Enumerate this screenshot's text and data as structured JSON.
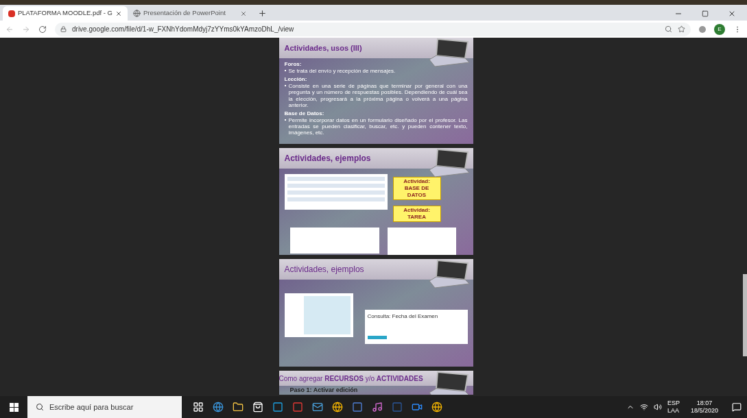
{
  "browser": {
    "tabs": [
      {
        "title": "PLATAFORMA MOODLE.pdf - G",
        "selected": true,
        "kind": "pdf"
      },
      {
        "title": "Presentación de PowerPoint",
        "selected": false,
        "kind": "web"
      }
    ],
    "url": "drive.google.com/file/d/1-w_FXNhYdomMdyj7zYYms0kYAmzoDhL_/view",
    "profile": "E"
  },
  "slides": [
    {
      "kind": "text",
      "title": "Actividades, usos (III)",
      "sections": [
        {
          "heading": "Foros:",
          "body": "Se trata del envío y recepción de mensajes."
        },
        {
          "heading": "Lección:",
          "body": "Consiste en una serie de páginas que terminar por general con una pregunta y un número de respuestas posibles. Dependiendo de cuál sea la elección, progresará a la próxima página o volverá a una página anterior."
        },
        {
          "heading": "Base de Datos:",
          "body": "Permite incorporar datos en un formulario diseñado por el profesor. Las entradas se pueden clasificar, buscar, etc. y pueden contener texto, imágenes, etc."
        }
      ]
    },
    {
      "kind": "callouts",
      "title": "Actividades, ejemplos",
      "callouts": [
        "Actividad: BASE DE DATOS",
        "Actividad: TAREA"
      ]
    },
    {
      "kind": "quiz",
      "title": "Actividades, ejemplos",
      "dialog_title": "Consulta: Fecha del Examen"
    },
    {
      "kind": "partial",
      "title_parts": [
        "Como agregar ",
        "RECURSOS",
        " y/o ",
        "ACTIVIDADES"
      ],
      "subtitle": "Paso 1: Activar edición"
    }
  ],
  "taskbar": {
    "search_placeholder": "Escribe aquí para buscar",
    "language": "ESP",
    "layout": "LAA",
    "time": "18:07",
    "date": "18/5/2020"
  }
}
